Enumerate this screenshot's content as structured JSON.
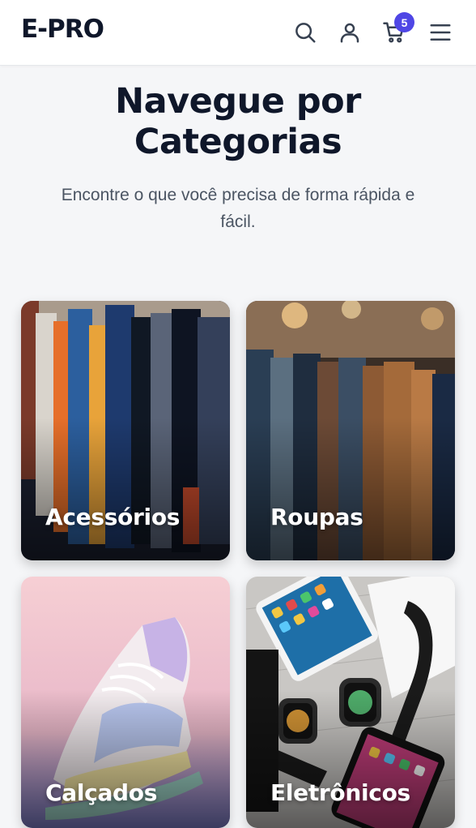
{
  "header": {
    "logo": "E-PRO",
    "cart_count": "5",
    "icons": [
      "search-icon",
      "user-icon",
      "cart-icon",
      "menu-icon"
    ]
  },
  "hero": {
    "title_line1": "Navegue por",
    "title_line2": "Categorias",
    "subtitle_line1": "Encontre o que você precisa de forma rápida e",
    "subtitle_line2": "fácil."
  },
  "categories": [
    {
      "label": "Acessórios"
    },
    {
      "label": "Roupas"
    },
    {
      "label": "Calçados"
    },
    {
      "label": "Eletrônicos"
    }
  ],
  "colors": {
    "accent": "#4f46e5",
    "heading": "#0f172a",
    "text": "#4b5563",
    "background": "#f5f6f8"
  }
}
